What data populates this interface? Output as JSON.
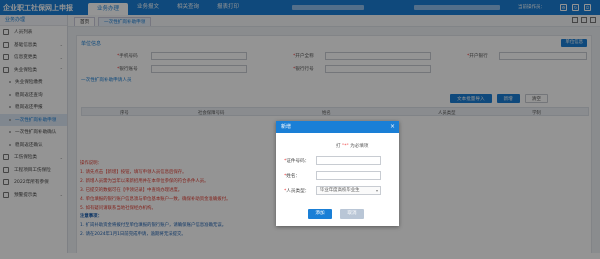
{
  "header": {
    "brand": "企业职工社保网上申报",
    "nav": [
      "业务办理",
      "业务报文",
      "相关查询",
      "报表打印"
    ],
    "active_nav": 0,
    "user": "当前操作员：",
    "icons": [
      "gear-icon",
      "refresh-icon",
      "logout-icon"
    ]
  },
  "sidebar": {
    "head": "业务办理",
    "items": [
      {
        "label": "人员列表",
        "type": "item"
      },
      {
        "label": "基础信息类",
        "type": "item",
        "expandable": true
      },
      {
        "label": "信息变更类",
        "type": "item",
        "expandable": true
      },
      {
        "label": "失业保险类",
        "type": "item",
        "expandable": true
      },
      {
        "label": "失业保险缴费",
        "type": "sub"
      },
      {
        "label": "稳岗返还查询",
        "type": "sub"
      },
      {
        "label": "稳岗返还申报",
        "type": "sub"
      },
      {
        "label": "一次性扩岗补助申领",
        "type": "sub",
        "active": true
      },
      {
        "label": "一次性扩岗补助确认",
        "type": "sub"
      },
      {
        "label": "稳岗返还确认",
        "type": "sub"
      },
      {
        "label": "工伤保险类",
        "type": "item",
        "expandable": true
      },
      {
        "label": "工程项目工伤保险",
        "type": "item"
      },
      {
        "label": "2022年所有参保",
        "type": "item"
      },
      {
        "label": "预警提示类",
        "type": "item",
        "expandable": true
      }
    ]
  },
  "tabs": [
    {
      "label": "首页",
      "current": false
    },
    {
      "label": "一次性扩岗补助申领",
      "current": true
    }
  ],
  "main": {
    "section1": "单位信息",
    "top_button": "单位信息",
    "fields": [
      {
        "label": "手机号码",
        "required": true
      },
      {
        "label": "开户全称",
        "required": true
      },
      {
        "label": "开户银行",
        "required": true
      },
      {
        "label": "银行账号",
        "required": true
      },
      {
        "label": "银行行号",
        "required": true
      }
    ],
    "section2": "一次性扩岗补助申请人员",
    "actions": [
      "文本批量导入",
      "新增",
      "清空"
    ],
    "table_headers": [
      "序号",
      "社会保障号码",
      "姓名",
      "人员类型",
      "学制"
    ],
    "notes": {
      "intro": "操作说明：",
      "steps": [
        "1. 请先点击【新增】按钮，填写申领人员信息后保存。",
        "2. 新增人员需为当年以来新招用并在本单位参保的符合条件人员。",
        "3. 已提交的数据可在【申领记录】中查询办理进度。",
        "4. 单位填报的银行账户信息须与单位基本账户一致，确保补助资金准确拨付。",
        "5. 如有疑问请联系当地社保经办机构。"
      ],
      "notice_title": "注意事项：",
      "notice": [
        "1. 扩岗补助资金将拨付至单位填报的银行账户，请确保账户信息准确无误。",
        "2. 请在2024年1月1日前完成申请，逾期将无法提交。"
      ]
    }
  },
  "modal": {
    "title": "新增",
    "tip_prefix": "打",
    "tip_mark": "\"*\"",
    "tip_suffix": "为必填项",
    "fields": [
      {
        "label": "证件号码：",
        "value": ""
      },
      {
        "label": "姓名：",
        "value": ""
      },
      {
        "label": "人员类型：",
        "value": "毕业年度高校毕业生"
      }
    ],
    "ok": "添加",
    "cancel": "取消"
  }
}
